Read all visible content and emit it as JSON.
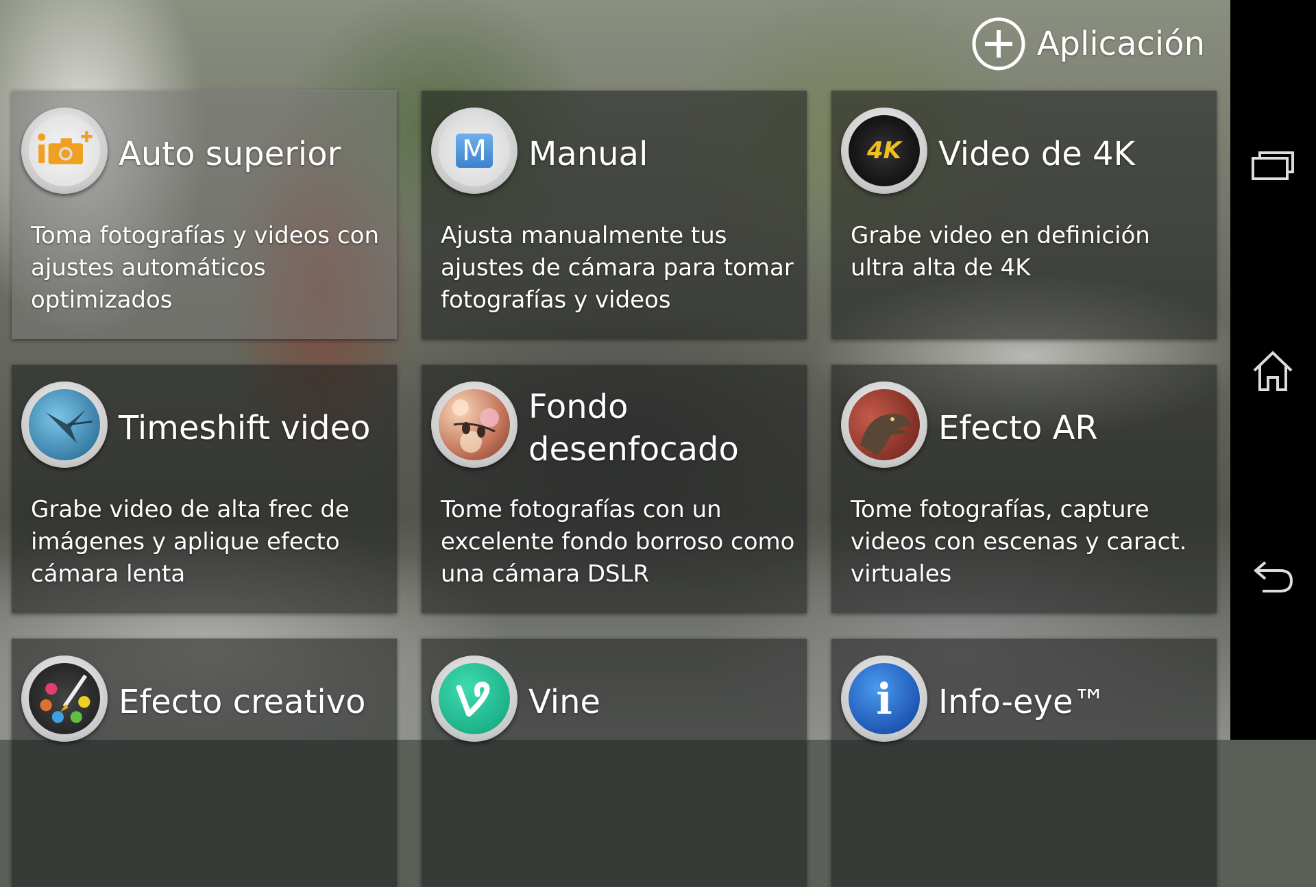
{
  "header": {
    "add_app_label": "Aplicación"
  },
  "modes": [
    {
      "title": "Auto superior",
      "description": "Toma fotografías y videos con ajustes automáticos optimizados",
      "icon": "camera-plus-icon"
    },
    {
      "title": "Manual",
      "description": "Ajusta manualmente tus ajustes de cámara para tomar fotografías y videos",
      "icon": "manual-m-icon",
      "icon_text": "M"
    },
    {
      "title": "Video de 4K",
      "description": "Grabe video en definición ultra alta de 4K",
      "icon": "4k-video-icon",
      "icon_text": "4K"
    },
    {
      "title": "Timeshift video",
      "description": "Grabe video de alta frec de imágenes y aplique efecto cámara lenta",
      "icon": "hummingbird-icon"
    },
    {
      "title": "Fondo desenfocado",
      "description": "Tome fotografías con un excelente fondo borroso como una cámara DSLR",
      "icon": "bokeh-blur-icon"
    },
    {
      "title": "Efecto AR",
      "description": "Tome fotografías, capture videos con escenas y caract. virtuales",
      "icon": "dinosaur-icon"
    },
    {
      "title": "Efecto creativo",
      "description": "",
      "icon": "palette-brush-icon"
    },
    {
      "title": "Vine",
      "description": "",
      "icon": "vine-icon"
    },
    {
      "title": "Info-eye™",
      "description": "",
      "icon": "info-icon",
      "icon_text": "i"
    }
  ],
  "nav": [
    "recent-apps-icon",
    "home-icon",
    "back-icon"
  ],
  "colors": {
    "navbar": "#000000",
    "text": "#ffffff",
    "vine": "#1fb88e",
    "info": "#1e64c8",
    "accent_orange": "#f0a020"
  }
}
